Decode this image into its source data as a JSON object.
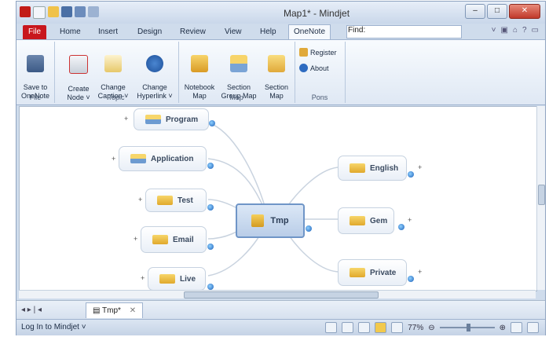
{
  "window": {
    "title": "Map1* - Mindjet"
  },
  "ribbon_tabs": [
    "File",
    "Home",
    "Insert",
    "Design",
    "Review",
    "View",
    "Help",
    "OneNote"
  ],
  "find_label": "Find:",
  "groups": {
    "file": {
      "label": "File",
      "save": "Save to\nOneNote"
    },
    "topic": {
      "label": "Topic",
      "create": "Create\nNode ˅",
      "change_caption": "Change\nCaption ˅",
      "change_hyperlink": "Change\nHyperlink ˅"
    },
    "map": {
      "label": "Map",
      "notebook": "Notebook\nMap",
      "section_group": "Section\nGroup Map",
      "section": "Section\nMap"
    },
    "pons": {
      "label": "Pons",
      "register": "Register",
      "about": "About"
    }
  },
  "map": {
    "central": "Tmp",
    "left_topics": [
      "Program",
      "Application",
      "Test",
      "Email",
      "Live"
    ],
    "right_topics": [
      "English",
      "Gem",
      "Private"
    ]
  },
  "doc_tab": "Tmp*",
  "status": {
    "login": "Log In to Mindjet ˅",
    "zoom": "77%"
  }
}
